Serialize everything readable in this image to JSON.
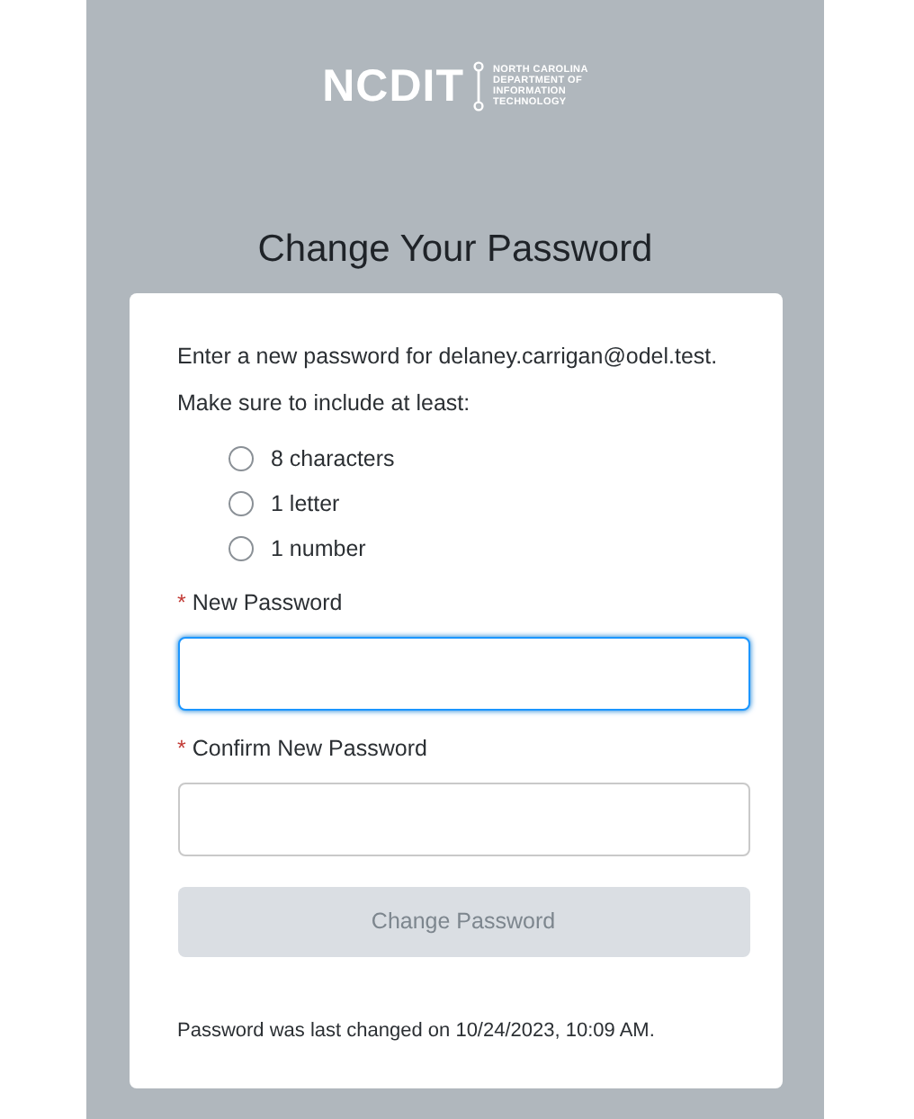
{
  "logo": {
    "wordmark": "NCDIT",
    "tagline": [
      "NORTH CAROLINA",
      "DEPARTMENT OF",
      "INFORMATION",
      "TECHNOLOGY"
    ]
  },
  "title": "Change Your Password",
  "intro": "Enter a new password for delaney.carrigan@odel.test.",
  "hint": "Make sure to include at least:",
  "requirements": [
    {
      "label": "8 characters",
      "checked": false
    },
    {
      "label": "1 letter",
      "checked": false
    },
    {
      "label": "1 number",
      "checked": false
    }
  ],
  "fields": [
    {
      "label": "New Password",
      "required_mark": "*",
      "focused": true
    },
    {
      "label": "Confirm New Password",
      "required_mark": "*",
      "focused": false
    }
  ],
  "submit": {
    "label": "Change Password",
    "disabled": true
  },
  "footer": "Password was last changed on 10/24/2023, 10:09 AM."
}
